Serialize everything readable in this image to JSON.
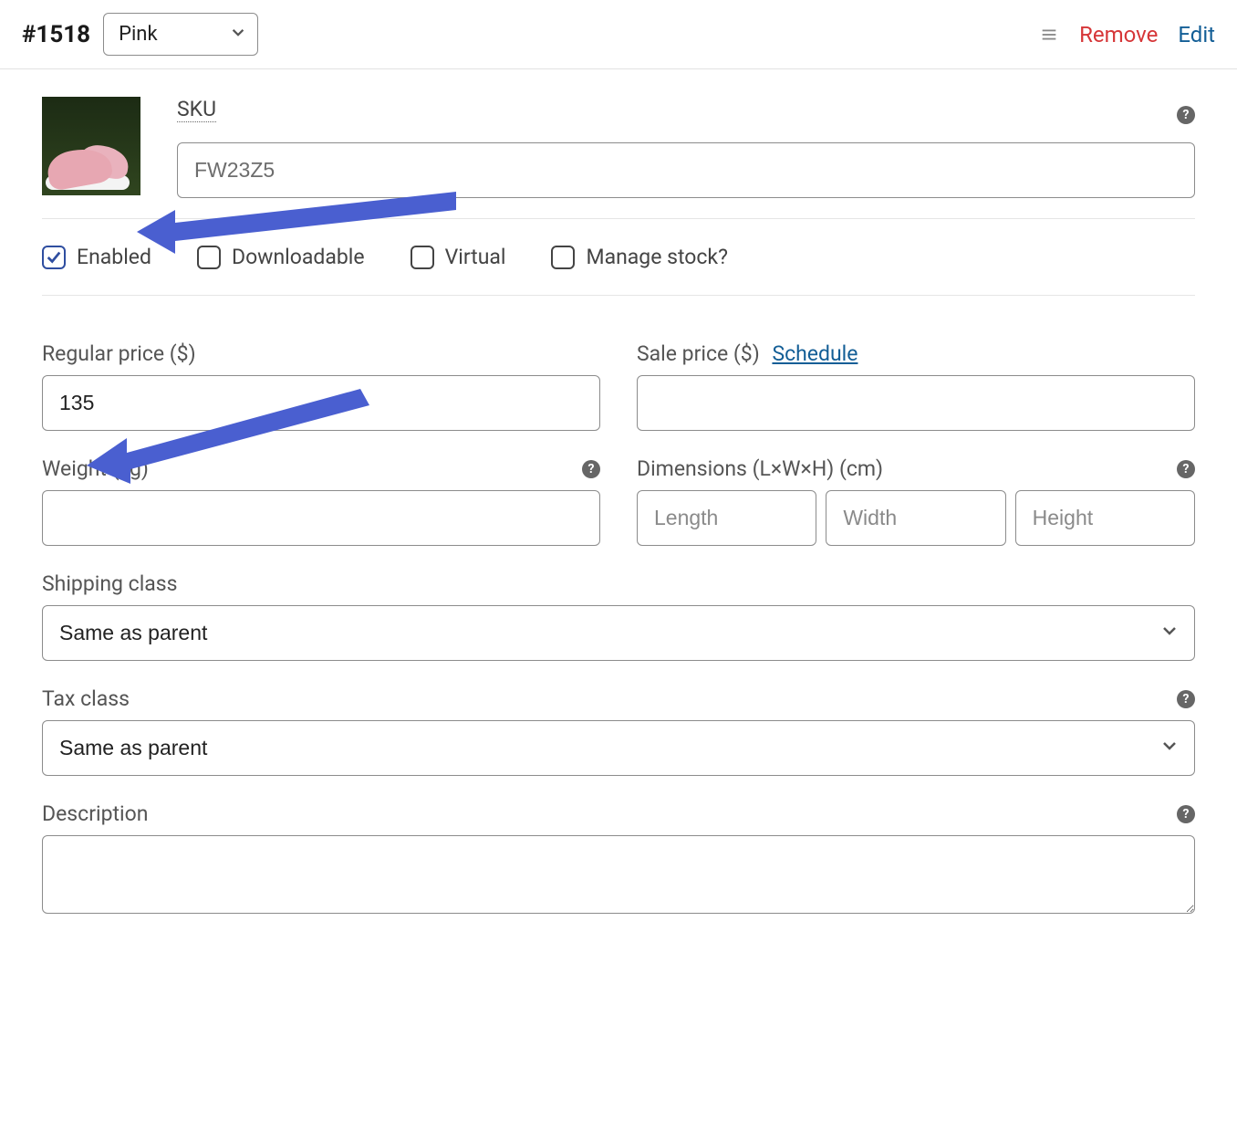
{
  "header": {
    "variation_id": "#1518",
    "variant_selected": "Pink",
    "remove_label": "Remove",
    "edit_label": "Edit"
  },
  "sku": {
    "label": "SKU",
    "value": "FW23Z5"
  },
  "checkboxes": {
    "enabled": {
      "label": "Enabled",
      "checked": true
    },
    "downloadable": {
      "label": "Downloadable",
      "checked": false
    },
    "virtual": {
      "label": "Virtual",
      "checked": false
    },
    "manage_stock": {
      "label": "Manage stock?",
      "checked": false
    }
  },
  "pricing": {
    "regular_label": "Regular price ($)",
    "regular_value": "135",
    "sale_label": "Sale price ($)",
    "sale_value": "",
    "schedule_label": "Schedule"
  },
  "shipping": {
    "weight_label": "Weight (kg)",
    "weight_value": "",
    "dimensions_label": "Dimensions (L×W×H) (cm)",
    "length_placeholder": "Length",
    "width_placeholder": "Width",
    "height_placeholder": "Height"
  },
  "shipping_class": {
    "label": "Shipping class",
    "value": "Same as parent"
  },
  "tax_class": {
    "label": "Tax class",
    "value": "Same as parent"
  },
  "description": {
    "label": "Description",
    "value": ""
  }
}
